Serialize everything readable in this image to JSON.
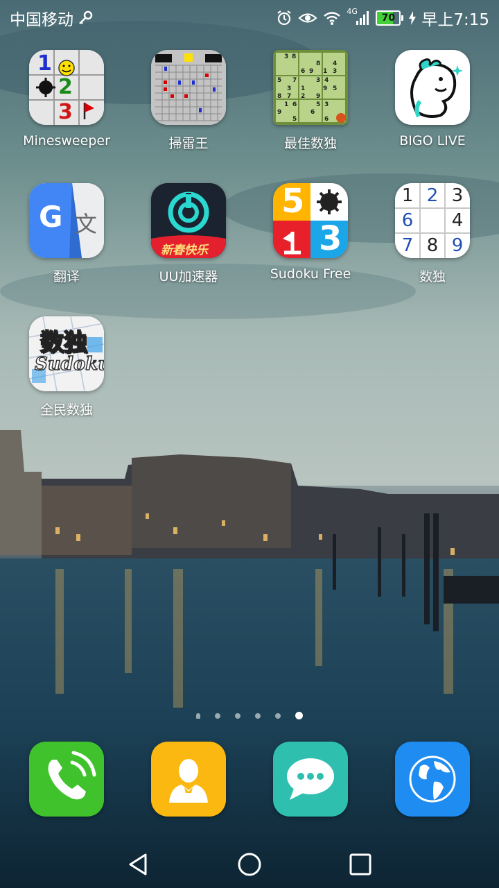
{
  "status_bar": {
    "carrier": "中国移动",
    "network": "4G",
    "battery": "70",
    "time": "早上7:15"
  },
  "apps": [
    {
      "label": "Minesweeper",
      "icon": "minesweeper-icon"
    },
    {
      "label": "掃雷王",
      "icon": "minesweeper-king-icon"
    },
    {
      "label": "最佳数独",
      "icon": "best-sudoku-icon"
    },
    {
      "label": "BIGO LIVE",
      "icon": "bigo-live-icon"
    },
    {
      "label": "翻译",
      "icon": "translate-icon"
    },
    {
      "label": "UU加速器",
      "icon": "uu-accelerator-icon"
    },
    {
      "label": "Sudoku Free",
      "icon": "sudoku-free-icon"
    },
    {
      "label": "数独",
      "icon": "sudoku-icon"
    },
    {
      "label": "全民数独",
      "icon": "quanmin-sudoku-icon"
    }
  ],
  "icon_text": {
    "uu_banner": "新春快乐",
    "quanmin_title": "数独",
    "quanmin_sub": "Sudoku",
    "translate_g": "G",
    "translate_wen": "文",
    "sudoku_digits": [
      "1",
      "2",
      "3",
      "6",
      "",
      "4",
      "7",
      "8",
      "9"
    ],
    "sudoku_free_5": "5",
    "sudoku_free_1": "1",
    "sudoku_free_3": "3",
    "mine_1": "1",
    "mine_2": "2",
    "mine_3": "3"
  },
  "page_indicator": {
    "count": 6,
    "active": 5
  },
  "dock": [
    {
      "icon": "phone-icon",
      "color": "#3fc22c"
    },
    {
      "icon": "contacts-icon",
      "color": "#fbb811"
    },
    {
      "icon": "messages-icon",
      "color": "#2ebfae"
    },
    {
      "icon": "browser-icon",
      "color": "#1e8cf0"
    }
  ],
  "nav": {
    "back": "back-icon",
    "home": "home-icon",
    "recents": "recents-icon"
  }
}
